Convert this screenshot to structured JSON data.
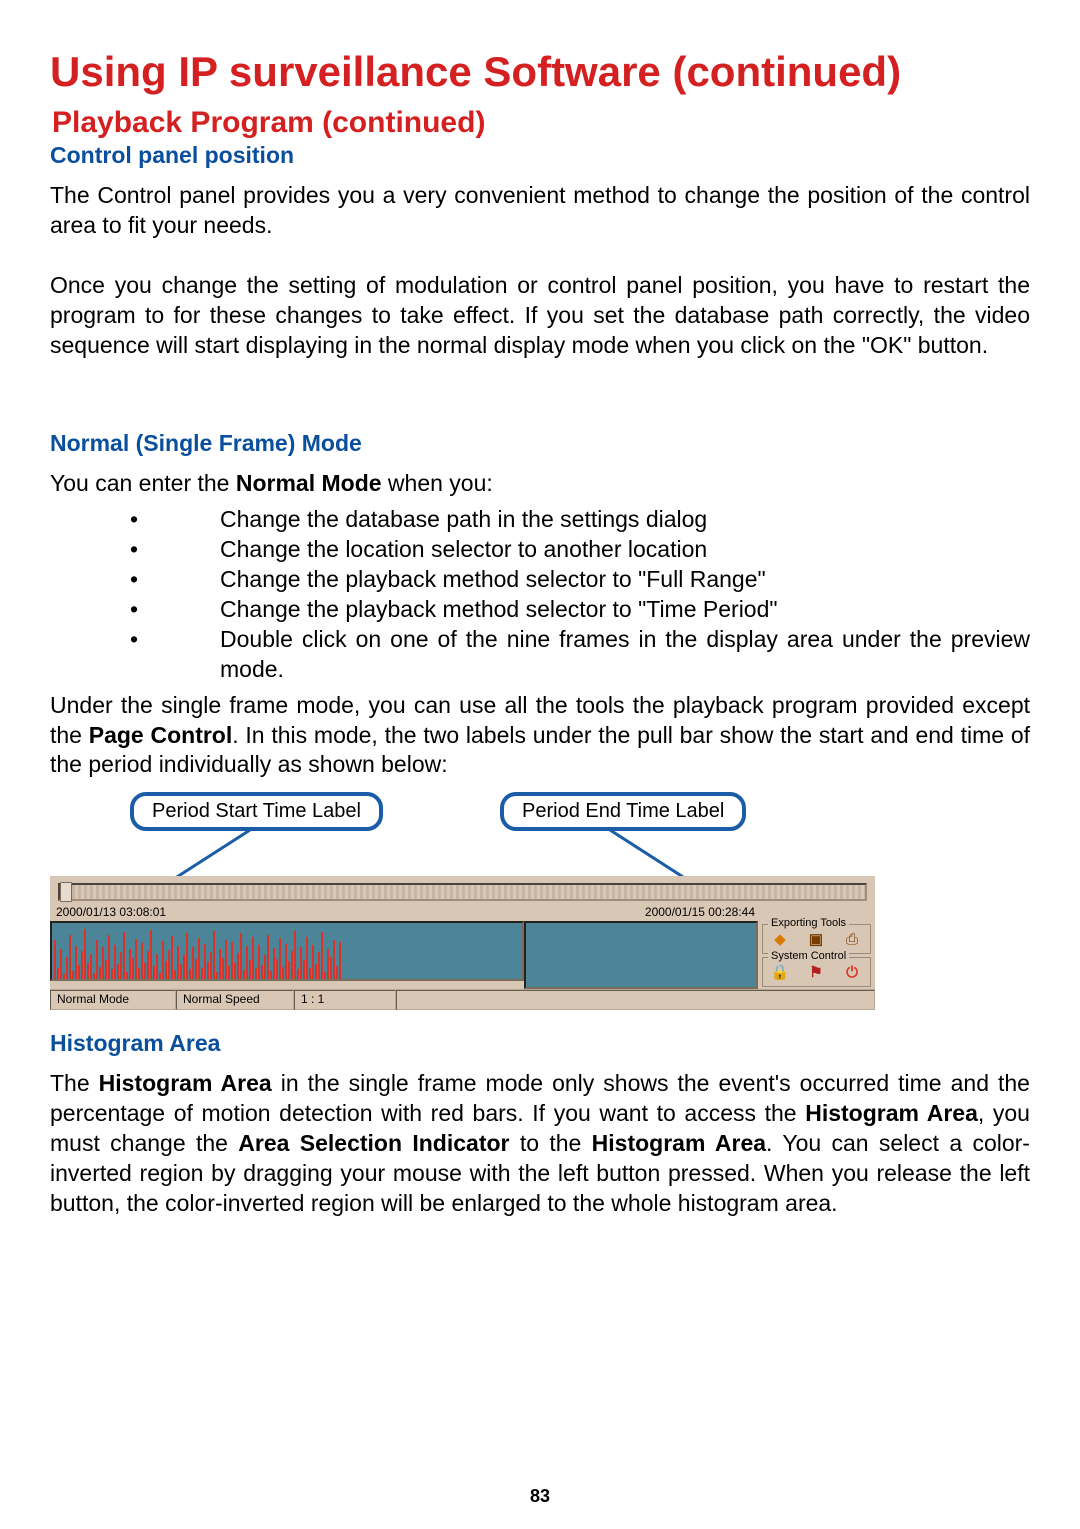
{
  "heading": "Using IP surveillance Software (continued)",
  "subheading": "Playback  Program  (continued)",
  "section_control_panel": "Control panel position",
  "para1": "The Control panel provides you a very convenient method to change the position of the control area to fit your needs.",
  "para2": "Once you change the setting of modulation or control panel position, you have to restart the program to for these changes to take effect. If you set the database path correctly, the video sequence will start displaying in the normal display mode when you click on the \"OK\" button.",
  "section_normal_mode": "Normal (Single Frame) Mode",
  "para3_prefix": "You can enter the ",
  "para3_bold": "Normal Mode",
  "para3_suffix": " when you:",
  "bullets": [
    "Change the database path in the settings dialog",
    "Change the location selector to another location",
    "Change the playback method selector to \"Full Range\"",
    "Change the playback method selector to \"Time Period\"",
    "Double click on one of the nine frames in the display area under the preview mode."
  ],
  "para4_part1": "Under the single frame mode, you can use all the tools the playback program provided except the ",
  "para4_bold1": "Page Control",
  "para4_part2": ". In this mode, the two labels under the pull bar show the start and end time of the period individually as shown below:",
  "callout_left": "Period Start Time Label",
  "callout_right": "Period End Time Label",
  "figure": {
    "time_start": "2000/01/13 03:08:01",
    "time_end": "2000/01/15 00:28:44",
    "exporting_tools_label": "Exporting Tools",
    "system_control_label": "System Control",
    "status": {
      "mode": "Normal Mode",
      "speed": "Normal Speed",
      "ratio": "1 : 1"
    },
    "icons": {
      "export1": "diamond-orange-icon",
      "export2": "camera-icon",
      "export3": "printer-icon",
      "sys1": "gear-icon",
      "sys2": "flag-icon",
      "sys3": "power-icon"
    }
  },
  "section_histogram": "Histogram Area",
  "para5_part1": "The ",
  "para5_bold1": "Histogram Area",
  "para5_part2": " in the single frame mode only shows the event's occurred time and the percentage of motion detection with red bars. If you want to access the ",
  "para5_bold2": "Histogram Area",
  "para5_part3": ", you must change the ",
  "para5_bold3": "Area Selection Indicator",
  "para5_part4": " to the ",
  "para5_bold4": "Histogram Area",
  "para5_part5": ". You can select a color-inverted region by dragging your mouse with the left button pressed. When you release the left button, the color-inverted region will be enlarged to the whole histogram area.",
  "page_number": "83"
}
